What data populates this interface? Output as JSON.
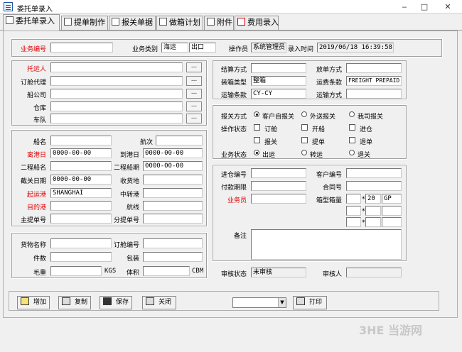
{
  "window": {
    "title": "委托单录入",
    "minimize": "‒",
    "maximize": "□",
    "close": "✕"
  },
  "tabs": [
    "委托单录入",
    "提单制作",
    "报关单据",
    "做箱计划",
    "附件",
    "费用录入"
  ],
  "header": {
    "business_no_label": "业务编号",
    "business_no": "",
    "business_type_label": "业务类别",
    "business_type_1": "海运",
    "business_type_2": "出口",
    "operator_label": "操作员",
    "operator": "系统管理员",
    "entry_time_label": "录入时间",
    "entry_time": "2019/06/18 16:39:58"
  },
  "parties": {
    "shipper_label": "托运人",
    "booking_agent_label": "订舱代理",
    "shipping_company_label": "船公司",
    "warehouse_label": "仓库",
    "fleet_label": "车队",
    "lookup_button": "..."
  },
  "voyage": {
    "vessel_label": "船名",
    "voyage_label": "航次",
    "departure_date_label": "离港日",
    "departure_date": "0000-00-00",
    "arrival_date_label": "到港日",
    "arrival_date": "0000-00-00",
    "second_vessel_label": "二程船名",
    "second_sail_label": "二程船期",
    "second_sail": "0000-00-00",
    "cutoff_date_label": "截关日期",
    "cutoff_date": "0000-00-00",
    "receipt_place_label": "收货地",
    "pol_label": "起运港",
    "pol": "SHANGHAI",
    "transship_label": "中转港",
    "pod_label": "目的港",
    "route_label": "航线",
    "master_bl_label": "主提单号",
    "house_bl_label": "分提单号"
  },
  "cargo": {
    "goods_name_label": "货物名称",
    "booking_no_label": "订舱编号",
    "pieces_label": "件数",
    "packing_label": "包装",
    "gross_weight_label": "毛重",
    "weight_unit": "KGS",
    "volume_label": "体积",
    "volume_unit": "CBM"
  },
  "terms": {
    "settlement_label": "结算方式",
    "release_label": "放单方式",
    "container_type_label": "装箱类型",
    "container_type": "整箱",
    "freight_term_label": "运费条款",
    "freight_term": "FREIGHT PREPAID",
    "transport_term_label": "运输条款",
    "transport_term": "CY-CY",
    "transport_mode_label": "运输方式"
  },
  "customs": {
    "declare_label": "报关方式",
    "declare_options": [
      "客户自报关",
      "外送报关",
      "我司报关"
    ],
    "status_label": "操作状态",
    "status_options": [
      "订舱",
      "开船",
      "进仓",
      "报关",
      "提单",
      "退单"
    ],
    "business_state_label": "业务状态",
    "business_state_options": [
      "出运",
      "转运",
      "退关"
    ]
  },
  "misc": {
    "warehouse_no_label": "进仓编号",
    "customer_no_label": "客户编号",
    "payment_term_label": "付款期限",
    "contract_no_label": "合同号",
    "salesman_label": "业务员",
    "container_label": "箱型箱量",
    "container_qty": "20",
    "container_type_code": "GP",
    "container_sep": "*",
    "remarks_label": "备注",
    "audit_state_label": "审核状态",
    "audit_state": "未审核",
    "auditor_label": "审核人"
  },
  "buttons": {
    "add": "增加",
    "copy": "复制",
    "save": "保存",
    "close": "关闭",
    "print": "打印"
  },
  "watermark": "3HE 当游网"
}
